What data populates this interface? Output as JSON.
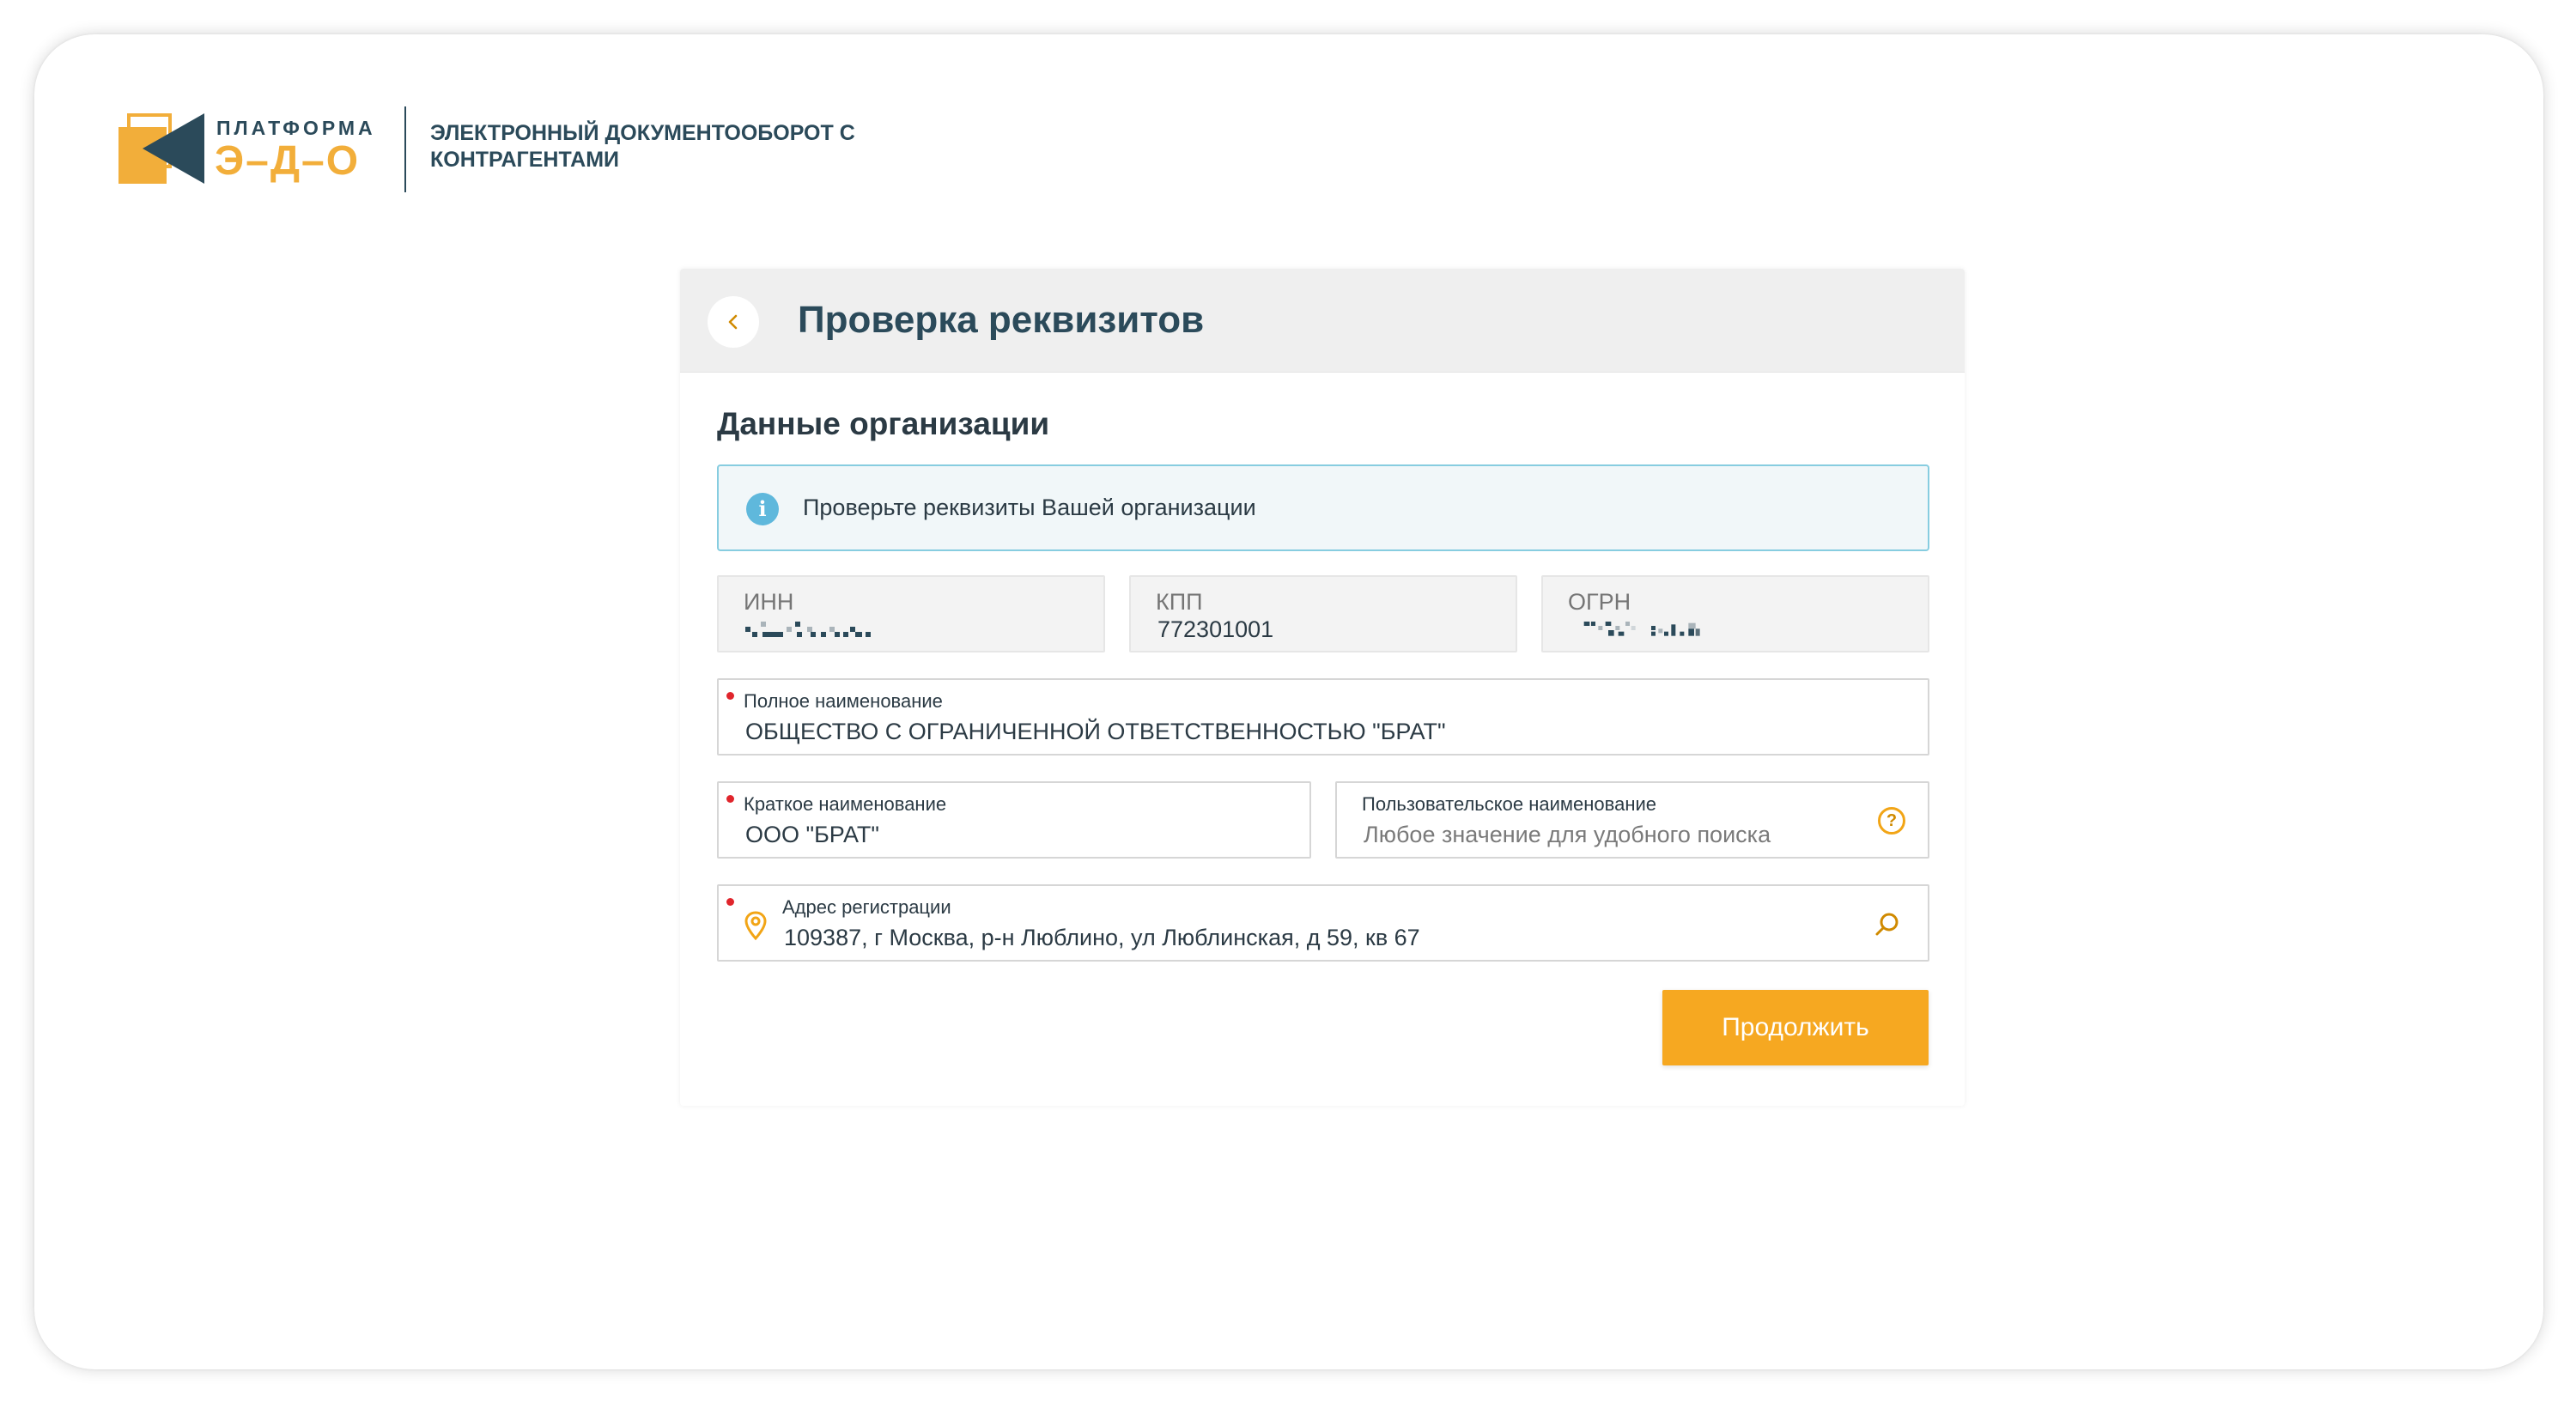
{
  "header": {
    "logo_line1": "ПЛАТФОРМА",
    "logo_line2": "Э–Д–О",
    "subtitle": "ЭЛЕКТРОННЫЙ ДОКУМЕНТООБОРОТ С КОНТРАГЕНТАМИ"
  },
  "card": {
    "title": "Проверка реквизитов",
    "section_title": "Данные организации",
    "info_text": "Проверьте реквизиты Вашей организации",
    "fields": {
      "inn": {
        "label": "ИНН",
        "value": ""
      },
      "kpp": {
        "label": "КПП",
        "value": "772301001"
      },
      "ogrn": {
        "label": "ОГРН",
        "value": ""
      },
      "full_name": {
        "label": "Полное наименование",
        "value": "ОБЩЕСТВО С ОГРАНИЧЕННОЙ ОТВЕТСТВЕННОСТЬЮ \"БРАТ\""
      },
      "short_name": {
        "label": "Краткое наименование",
        "value": "ООО \"БРАТ\""
      },
      "custom_name": {
        "label": "Пользовательское наименование",
        "placeholder": "Любое значение для удобного поиска"
      },
      "address": {
        "label": "Адрес регистрации",
        "value": "109387, г Москва, р-н Люблино, ул Люблинская, д 59, кв 67"
      }
    },
    "continue_label": "Продолжить"
  },
  "colors": {
    "accent": "#f6a821",
    "brand_dark": "#2b4a5a",
    "info_border": "#87cde0",
    "required": "#e0252c"
  },
  "icons": {
    "back": "chevron-left-icon",
    "info": "info-icon",
    "help": "question-icon",
    "location": "map-pin-icon",
    "search": "search-icon"
  }
}
